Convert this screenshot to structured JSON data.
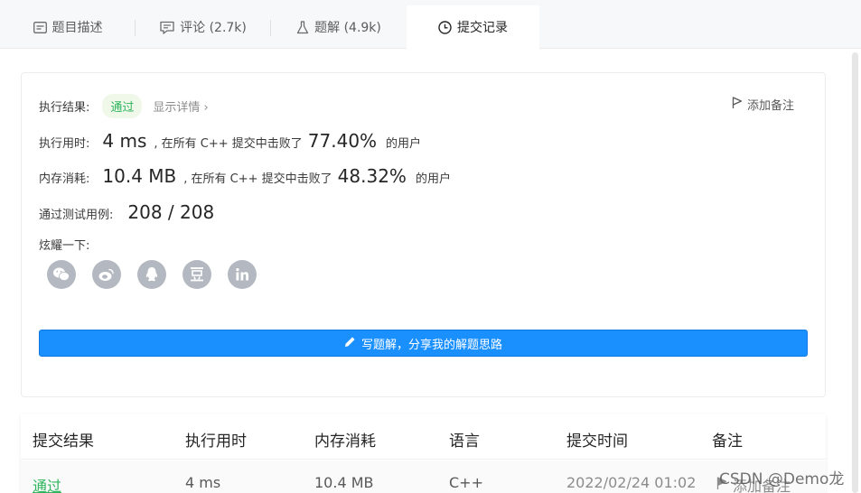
{
  "tabs": [
    {
      "label": "题目描述",
      "icon": "description-icon"
    },
    {
      "label": "评论 (2.7k)",
      "icon": "comment-icon"
    },
    {
      "label": "题解 (4.9k)",
      "icon": "flask-icon"
    },
    {
      "label": "提交记录",
      "icon": "clock-icon",
      "active": true
    }
  ],
  "result": {
    "label": "执行结果:",
    "status": "通过",
    "details_link": "显示详情 ›",
    "add_note": "添加备注"
  },
  "runtime": {
    "label": "执行用时:",
    "value": "4 ms",
    "prefix": ", 在所有 C++ 提交中击败了",
    "percent": "77.40%",
    "suffix": "的用户"
  },
  "memory": {
    "label": "内存消耗:",
    "value": "10.4 MB",
    "prefix": ", 在所有 C++ 提交中击败了",
    "percent": "48.32%",
    "suffix": "的用户"
  },
  "tests": {
    "label": "通过测试用例:",
    "value": "208 / 208"
  },
  "share": {
    "label": "炫耀一下:",
    "icons": [
      "wechat-icon",
      "weibo-icon",
      "qq-icon",
      "douban-icon",
      "linkedin-icon"
    ]
  },
  "write_button": "写题解，分享我的解题思路",
  "table": {
    "headers": [
      "提交结果",
      "执行用时",
      "内存消耗",
      "语言",
      "提交时间",
      "备注"
    ],
    "rows": [
      {
        "result": "通过",
        "runtime": "4 ms",
        "memory": "10.4 MB",
        "language": "C++",
        "time": "2022/02/24 01:02",
        "note": "添加备注"
      }
    ]
  },
  "watermark": "CSDN @Demo龙",
  "colors": {
    "accent": "#1a90ff",
    "success": "#2db55d",
    "icon_gray": "#b4b8c0"
  }
}
